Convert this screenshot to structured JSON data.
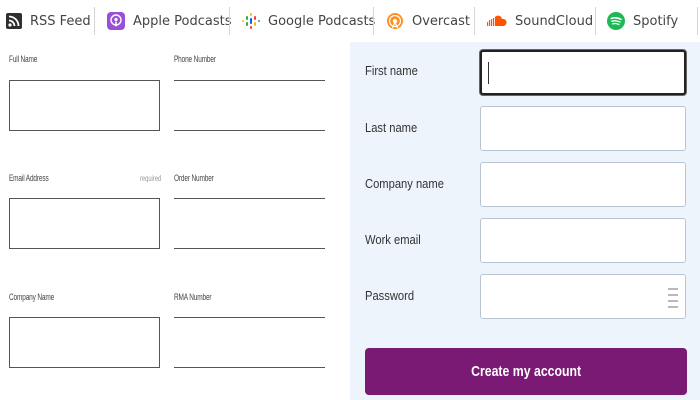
{
  "colors": {
    "accent": "#7b1a74",
    "apple": "#8e44ad",
    "overcast": "#f28a1f",
    "soundcloud": "#ff5500",
    "spotify": "#1db954",
    "rss": "#333333"
  },
  "podcast_bar": {
    "items": [
      {
        "label": "RSS Feed",
        "icon": "rss-icon"
      },
      {
        "label": "Apple Podcasts",
        "icon": "apple-podcasts-icon"
      },
      {
        "label": "Google Podcasts",
        "icon": "google-podcasts-icon"
      },
      {
        "label": "Overcast",
        "icon": "overcast-icon"
      },
      {
        "label": "SoundCloud",
        "icon": "soundcloud-icon"
      },
      {
        "label": "Spotify",
        "icon": "spotify-icon"
      }
    ]
  },
  "legacy_form": {
    "full_name": "Full Name",
    "phone_number": "Phone Number",
    "email_address": "Email Address",
    "required": "required",
    "order_number": "Order Number",
    "company_name": "Company Name",
    "rma_number": "RMA Number"
  },
  "signup_form": {
    "first_name": "First name",
    "last_name": "Last name",
    "company_name": "Company name",
    "work_email": "Work email",
    "password": "Password",
    "submit_label": "Create my account"
  }
}
